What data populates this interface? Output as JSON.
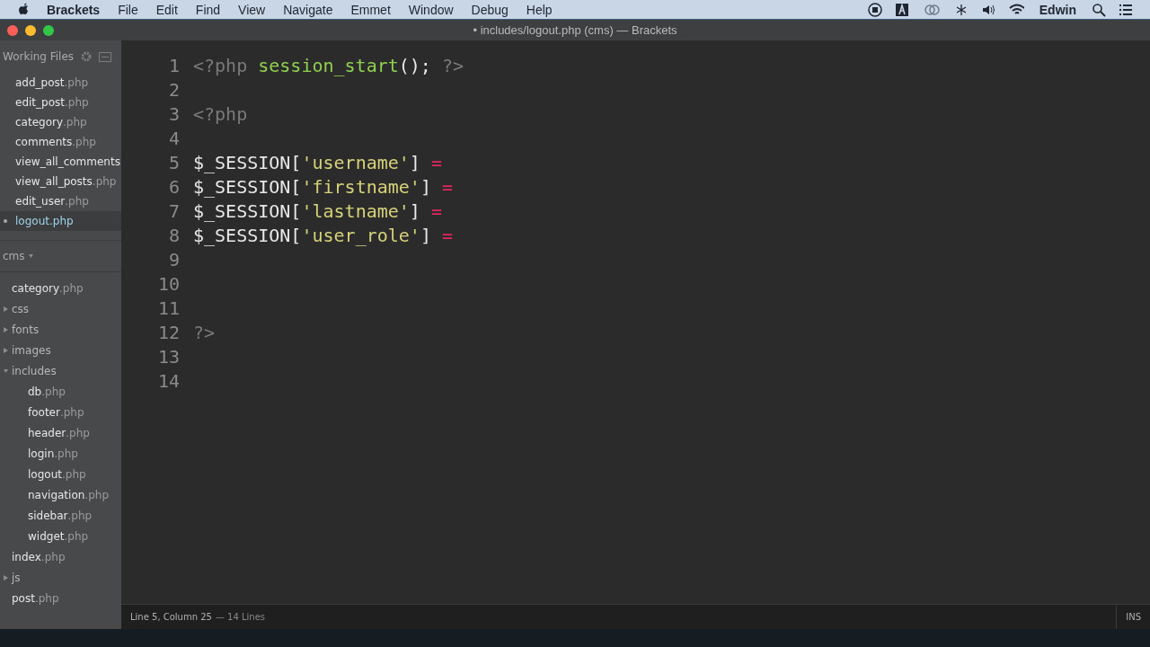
{
  "menu_bar": {
    "app": "Brackets",
    "items": [
      "File",
      "Edit",
      "Find",
      "View",
      "Navigate",
      "Emmet",
      "Window",
      "Debug",
      "Help"
    ],
    "user": "Edwin"
  },
  "window": {
    "title": "includes/logout.php (cms) — Brackets",
    "modified_dot": "•"
  },
  "working_files": {
    "title": "Working Files",
    "files": [
      {
        "name": "add_post",
        "ext": ".php",
        "selected": false
      },
      {
        "name": "edit_post",
        "ext": ".php",
        "selected": false
      },
      {
        "name": "category",
        "ext": ".php",
        "selected": false
      },
      {
        "name": "comments",
        "ext": ".php",
        "selected": false
      },
      {
        "name": "view_all_comments",
        "selected": false
      },
      {
        "name": "view_all_posts",
        "ext": ".php",
        "selected": false
      },
      {
        "name": "edit_user",
        "ext": ".php",
        "selected": false
      },
      {
        "name": "logout",
        "ext": ".php",
        "selected": true
      }
    ]
  },
  "project": {
    "name": "cms",
    "tree": [
      {
        "kind": "file",
        "name": "category",
        "ext": ".php"
      },
      {
        "kind": "folder",
        "name": "css",
        "expanded": false
      },
      {
        "kind": "folder",
        "name": "fonts",
        "expanded": false
      },
      {
        "kind": "folder",
        "name": "images",
        "expanded": false
      },
      {
        "kind": "folder",
        "name": "includes",
        "expanded": true,
        "children": [
          {
            "kind": "file",
            "name": "db",
            "ext": ".php"
          },
          {
            "kind": "file",
            "name": "footer",
            "ext": ".php"
          },
          {
            "kind": "file",
            "name": "header",
            "ext": ".php"
          },
          {
            "kind": "file",
            "name": "login",
            "ext": ".php"
          },
          {
            "kind": "file",
            "name": "logout",
            "ext": ".php"
          },
          {
            "kind": "file",
            "name": "navigation",
            "ext": ".php"
          },
          {
            "kind": "file",
            "name": "sidebar",
            "ext": ".php"
          },
          {
            "kind": "file",
            "name": "widget",
            "ext": ".php"
          }
        ]
      },
      {
        "kind": "file",
        "name": "index",
        "ext": ".php"
      },
      {
        "kind": "folder",
        "name": "js",
        "expanded": false
      },
      {
        "kind": "file",
        "name": "post",
        "ext": ".php"
      }
    ]
  },
  "editor": {
    "lines": [
      {
        "number": "1",
        "tokens": [
          {
            "kind": "tag",
            "text": "<?php"
          },
          {
            "kind": "func",
            "text": "session_start",
            "space_before": true
          },
          {
            "kind": "plain",
            "text": "();"
          },
          {
            "kind": "tag",
            "text": "?>",
            "space_before": true
          }
        ]
      },
      {
        "number": "2"
      },
      {
        "number": "3",
        "tokens": [
          {
            "kind": "tag",
            "text": "<?php"
          }
        ]
      },
      {
        "number": "4"
      },
      {
        "number": "5",
        "tokens": [
          {
            "kind": "plain",
            "text": "$_SESSION["
          },
          {
            "kind": "string",
            "text": "'username'"
          },
          {
            "kind": "plain",
            "text": "]"
          },
          {
            "kind": "op",
            "text": "=",
            "space_before": true
          }
        ]
      },
      {
        "number": "6",
        "tokens": [
          {
            "kind": "plain",
            "text": "$_SESSION["
          },
          {
            "kind": "string",
            "text": "'firstname'"
          },
          {
            "kind": "plain",
            "text": "]"
          },
          {
            "kind": "op",
            "text": "=",
            "space_before": true
          }
        ]
      },
      {
        "number": "7",
        "tokens": [
          {
            "kind": "plain",
            "text": "$_SESSION["
          },
          {
            "kind": "string",
            "text": "'lastname'"
          },
          {
            "kind": "plain",
            "text": "]"
          },
          {
            "kind": "op",
            "text": "=",
            "space_before": true
          }
        ]
      },
      {
        "number": "8",
        "tokens": [
          {
            "kind": "plain",
            "text": "$_SESSION["
          },
          {
            "kind": "string",
            "text": "'user_role'"
          },
          {
            "kind": "plain",
            "text": "]"
          },
          {
            "kind": "op",
            "text": "=",
            "space_before": true
          }
        ]
      },
      {
        "number": "9"
      },
      {
        "number": "10"
      },
      {
        "number": "11"
      },
      {
        "number": "12",
        "tokens": [
          {
            "kind": "tag",
            "text": "?>"
          }
        ]
      },
      {
        "number": "13"
      },
      {
        "number": "14"
      }
    ]
  },
  "status_bar": {
    "position": "Line 5, Column 25",
    "line_count": "— 14 Lines",
    "mode": "INS"
  }
}
